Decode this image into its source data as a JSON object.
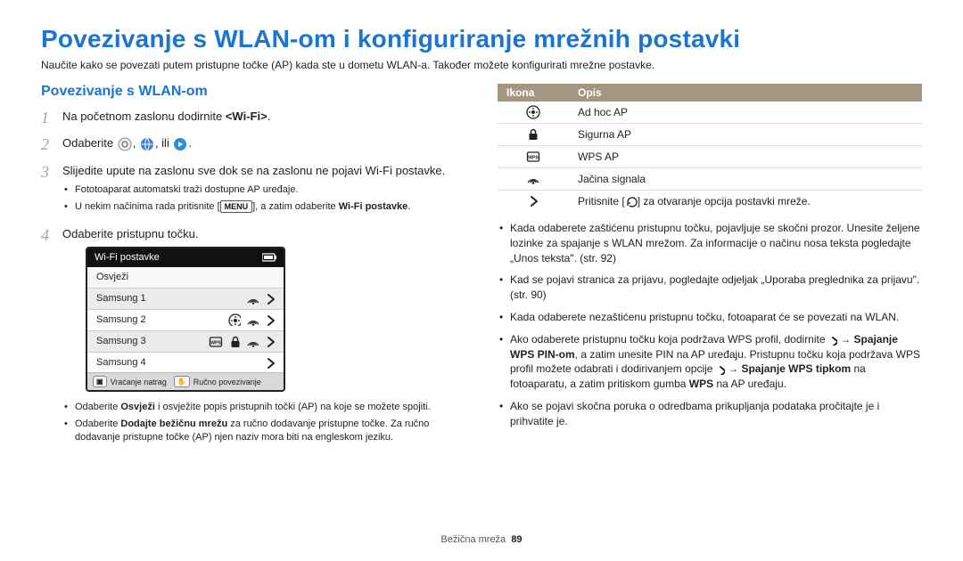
{
  "page_title": "Povezivanje s WLAN-om i konfiguriranje mrežnih postavki",
  "intro": "Naučite kako se povezati putem pristupne točke (AP) kada ste u dometu WLAN-a. Također možete konfigurirati mrežne postavke.",
  "section_title": "Povezivanje s WLAN-om",
  "steps": {
    "s1_num": "1",
    "s1_pre": "Na početnom zaslonu dodirnite ",
    "s1_strong": "<Wi-Fi>",
    "s1_post": ".",
    "s2_num": "2",
    "s2_pre": "Odaberite ",
    "s2_mid1": ", ",
    "s2_mid2": ", ili ",
    "s2_post": ".",
    "s3_num": "3",
    "s3_text": "Slijedite upute na zaslonu sve dok se na zaslonu ne pojavi Wi-Fi postavke.",
    "s3_b1": "Fototoaparat automatski traži dostupne AP uređaje.",
    "s3_b2_pre": "U nekim načinima rada pritisnite [",
    "s3_b2_menu": "MENU",
    "s3_b2_mid": "], a zatim odaberite ",
    "s3_b2_strong": "Wi-Fi postavke",
    "s3_b2_post": ".",
    "s4_num": "4",
    "s4_text": "Odaberite pristupnu točku."
  },
  "wifi_panel": {
    "title": "Wi-Fi postavke",
    "refresh": "Osvježi",
    "rows": [
      {
        "name": "Samsung 1"
      },
      {
        "name": "Samsung 2"
      },
      {
        "name": "Samsung 3"
      },
      {
        "name": "Samsung 4"
      }
    ],
    "footer_left_key": "▣",
    "footer_left": "Vraćanje natrag",
    "footer_right_key": "✋",
    "footer_right": "Ručno povezivanje"
  },
  "left_sub": {
    "b1_pre": "Odaberite ",
    "b1_strong": "Osvježi",
    "b1_post": " i osvježite popis pristupnih točki (AP) na koje se možete spojiti.",
    "b2_pre": "Odaberite ",
    "b2_strong": "Dodajte bežičnu mrežu",
    "b2_post": " za ručno dodavanje pristupne točke. Za ručno dodavanje pristupne točke (AP) njen naziv mora biti na engleskom jeziku."
  },
  "icon_table": {
    "h1": "Ikona",
    "h2": "Opis",
    "rows": [
      {
        "icon": "adhoc",
        "desc": "Ad hoc AP"
      },
      {
        "icon": "lock",
        "desc": "Sigurna AP"
      },
      {
        "icon": "wps",
        "desc": "WPS AP"
      },
      {
        "icon": "signal",
        "desc": "Jačina signala"
      }
    ],
    "last_pre": "Pritisnite [",
    "last_key": "↺",
    "last_post": "] za otvaranje opcija postavki mreže."
  },
  "right_bullets": {
    "b1": "Kada odaberete zaštićenu pristupnu točku, pojavljuje se skočni prozor. Unesite željene lozinke za spajanje s WLAN mrežom. Za informacije o načinu nosa teksta pogledajte „Unos teksta\". (str. 92)",
    "b2": "Kad se pojavi stranica za prijavu, pogledajte odjeljak „Uporaba preglednika za prijavu\". (str. 90)",
    "b3": "Kada odaberete nezaštićenu pristupnu točku, fotoaparat će se povezati na WLAN.",
    "b4_pre": "Ako odaberete pristupnu točku koja podržava WPS profil, dodirnite ",
    "b4_arrow": " → ",
    "b4_s1": "Spajanje WPS PIN-om",
    "b4_mid1": ", a zatim unesite PIN na AP uređaju. Pristupnu točku koja podržava WPS profil možete odabrati i dodirivanjem opcije ",
    "b4_arrow2": " → ",
    "b4_s2": "Spajanje WPS tipkom",
    "b4_mid2": " na fotoaparatu, a zatim pritiskom gumba ",
    "b4_s3": "WPS",
    "b4_post": " na AP uređaju.",
    "b5": "Ako se pojavi skočna poruka o odredbama prikupljanja podataka pročitajte je i prihvatite je."
  },
  "footer": {
    "section": "Bežična mreža",
    "page": "89"
  }
}
